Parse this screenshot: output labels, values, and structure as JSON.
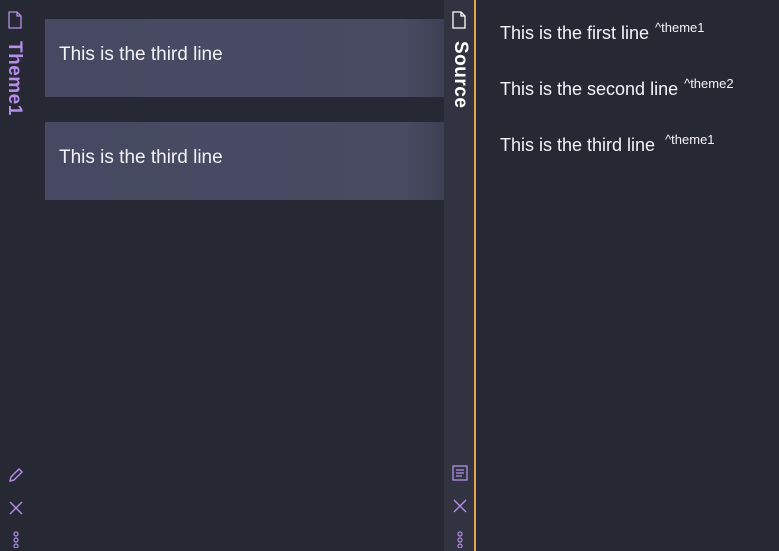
{
  "left_pane": {
    "vertical_title": "Theme1",
    "cards": [
      {
        "text": "This is the third line"
      },
      {
        "text": "This is the third line"
      }
    ],
    "icons": {
      "tab": "file-icon",
      "bottom": [
        "pencil-icon",
        "close-icon",
        "more-vertical-icon"
      ]
    }
  },
  "right_pane": {
    "vertical_title": "Source",
    "lines": [
      {
        "text": "This is the first line",
        "ref": "^theme1"
      },
      {
        "text": "This is the second line",
        "ref": "^theme2"
      },
      {
        "text": "This is the third line",
        "ref": "^theme1"
      }
    ],
    "icons": {
      "tab": "file-icon",
      "bottom": [
        "document-lines-icon",
        "close-icon",
        "more-vertical-icon"
      ]
    }
  },
  "colors": {
    "background": "#262834",
    "card": "#484b62",
    "accent_purple": "#b48ee8",
    "active_divider": "#e8a24b"
  }
}
